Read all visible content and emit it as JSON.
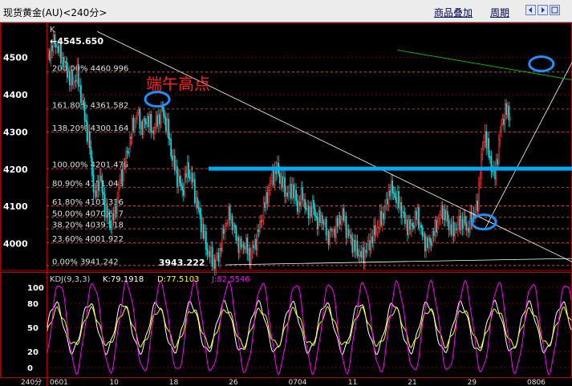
{
  "titlebar": {
    "title": "现货黄金(AU)<240分>",
    "overlay_label": "商品叠加",
    "period_label": "周期"
  },
  "chart_data": [
    {
      "type": "candlestick",
      "panel_label": "K",
      "ylim": [
        3930,
        4590
      ],
      "y_ticks": [
        4000,
        4100,
        4200,
        4300,
        4400,
        4500
      ],
      "grid": true,
      "high_label": "4545.650",
      "low_label": "3943.222",
      "annotation": "端午高点",
      "fib_levels": [
        {
          "label": "200.00%",
          "value": 4460.996
        },
        {
          "label": "161.80%",
          "value": 4361.582
        },
        {
          "label": "138.20%",
          "value": 4300.164
        },
        {
          "label": "100.00%",
          "value": 4201.475
        },
        {
          "label": "80.90%",
          "value": 4151.043
        },
        {
          "label": "61.80%",
          "value": 4101.336
        },
        {
          "label": "50.00%",
          "value": 4070.627
        },
        {
          "label": "38.20%",
          "value": 4039.918
        },
        {
          "label": "23.60%",
          "value": 4001.922
        },
        {
          "label": "0.00%",
          "value": 3941.242
        }
      ],
      "key_level": 4201.475,
      "path": [
        [
          0,
          4500
        ],
        [
          6,
          4545
        ],
        [
          14,
          4480
        ],
        [
          20,
          4430
        ],
        [
          24,
          4455
        ],
        [
          30,
          4340
        ],
        [
          34,
          4260
        ],
        [
          38,
          4120
        ],
        [
          42,
          4180
        ],
        [
          46,
          4100
        ],
        [
          50,
          4050
        ],
        [
          54,
          4080
        ],
        [
          58,
          4170
        ],
        [
          63,
          4230
        ],
        [
          68,
          4310
        ],
        [
          72,
          4350
        ],
        [
          76,
          4310
        ],
        [
          80,
          4340
        ],
        [
          84,
          4300
        ],
        [
          88,
          4330
        ],
        [
          92,
          4360
        ],
        [
          96,
          4310
        ],
        [
          100,
          4230
        ],
        [
          104,
          4180
        ],
        [
          108,
          4140
        ],
        [
          112,
          4200
        ],
        [
          116,
          4170
        ],
        [
          120,
          4100
        ],
        [
          124,
          4040
        ],
        [
          128,
          3980
        ],
        [
          132,
          3960
        ],
        [
          134,
          3943
        ],
        [
          138,
          3980
        ],
        [
          142,
          4050
        ],
        [
          146,
          4080
        ],
        [
          150,
          4030
        ],
        [
          154,
          3990
        ],
        [
          158,
          4000
        ],
        [
          162,
          3965
        ],
        [
          168,
          4020
        ],
        [
          172,
          4080
        ],
        [
          176,
          4130
        ],
        [
          180,
          4180
        ],
        [
          184,
          4200
        ],
        [
          188,
          4160
        ],
        [
          192,
          4130
        ],
        [
          196,
          4150
        ],
        [
          200,
          4100
        ],
        [
          204,
          4130
        ],
        [
          208,
          4080
        ],
        [
          212,
          4100
        ],
        [
          216,
          4060
        ],
        [
          220,
          4070
        ],
        [
          224,
          4020
        ],
        [
          230,
          4040
        ],
        [
          236,
          4080
        ],
        [
          240,
          4030
        ],
        [
          244,
          4000
        ],
        [
          248,
          3980
        ],
        [
          252,
          3965
        ],
        [
          256,
          3990
        ],
        [
          262,
          4030
        ],
        [
          266,
          4060
        ],
        [
          270,
          4090
        ],
        [
          274,
          4150
        ],
        [
          278,
          4130
        ],
        [
          282,
          4100
        ],
        [
          286,
          4060
        ],
        [
          290,
          4040
        ],
        [
          296,
          4080
        ],
        [
          300,
          4020
        ],
        [
          304,
          3995
        ],
        [
          308,
          4020
        ],
        [
          312,
          4060
        ],
        [
          316,
          4090
        ],
        [
          320,
          4060
        ],
        [
          324,
          4030
        ],
        [
          328,
          4050
        ],
        [
          332,
          4060
        ],
        [
          336,
          4040
        ],
        [
          340,
          4075
        ],
        [
          344,
          4100
        ],
        [
          346,
          4200
        ],
        [
          350,
          4300
        ],
        [
          354,
          4220
        ],
        [
          358,
          4180
        ],
        [
          362,
          4300
        ],
        [
          366,
          4360
        ],
        [
          370,
          4340
        ]
      ],
      "indicator_lines": [
        {
          "color": "#ffffff",
          "points": [
            [
              40,
              4570
            ],
            [
              420,
              3950
            ]
          ]
        },
        {
          "color": "#ffffff",
          "points": [
            [
              143,
              3943
            ],
            [
              420,
              3960
            ]
          ]
        },
        {
          "color": "#ffffff",
          "points": [
            [
              350,
              4040
            ],
            [
              420,
              4490
            ]
          ]
        },
        {
          "color": "#00cc00",
          "points": [
            [
              280,
              4520
            ],
            [
              420,
              4440
            ]
          ]
        }
      ],
      "ellipses": [
        {
          "x": 88,
          "y": 4388
        },
        {
          "x": 349,
          "y": 4058
        },
        {
          "x": 395,
          "y": 4483
        }
      ]
    },
    {
      "type": "line",
      "panel_label": "KDJ(9,3,3)",
      "readout": {
        "k": "K:79.1918",
        "d": "D:77.5103",
        "j": "J:82.5546"
      },
      "ylim": [
        -12,
        118
      ],
      "y_ticks": [
        0,
        20,
        50,
        80,
        100
      ],
      "grid": true,
      "x_tick_labels": [
        "0601",
        "10",
        "18",
        "26",
        "0704",
        "11",
        "21",
        "29",
        "0806"
      ],
      "series": [
        {
          "name": "K",
          "color": "#ffffff",
          "period_bars": 9,
          "amplitude": 30
        },
        {
          "name": "D",
          "color": "#ffff00",
          "period_bars": 9,
          "amplitude": 22
        },
        {
          "name": "J",
          "color": "#ff00ff",
          "period_bars": 9,
          "amplitude": 55
        }
      ],
      "bar_label": "240分"
    }
  ]
}
